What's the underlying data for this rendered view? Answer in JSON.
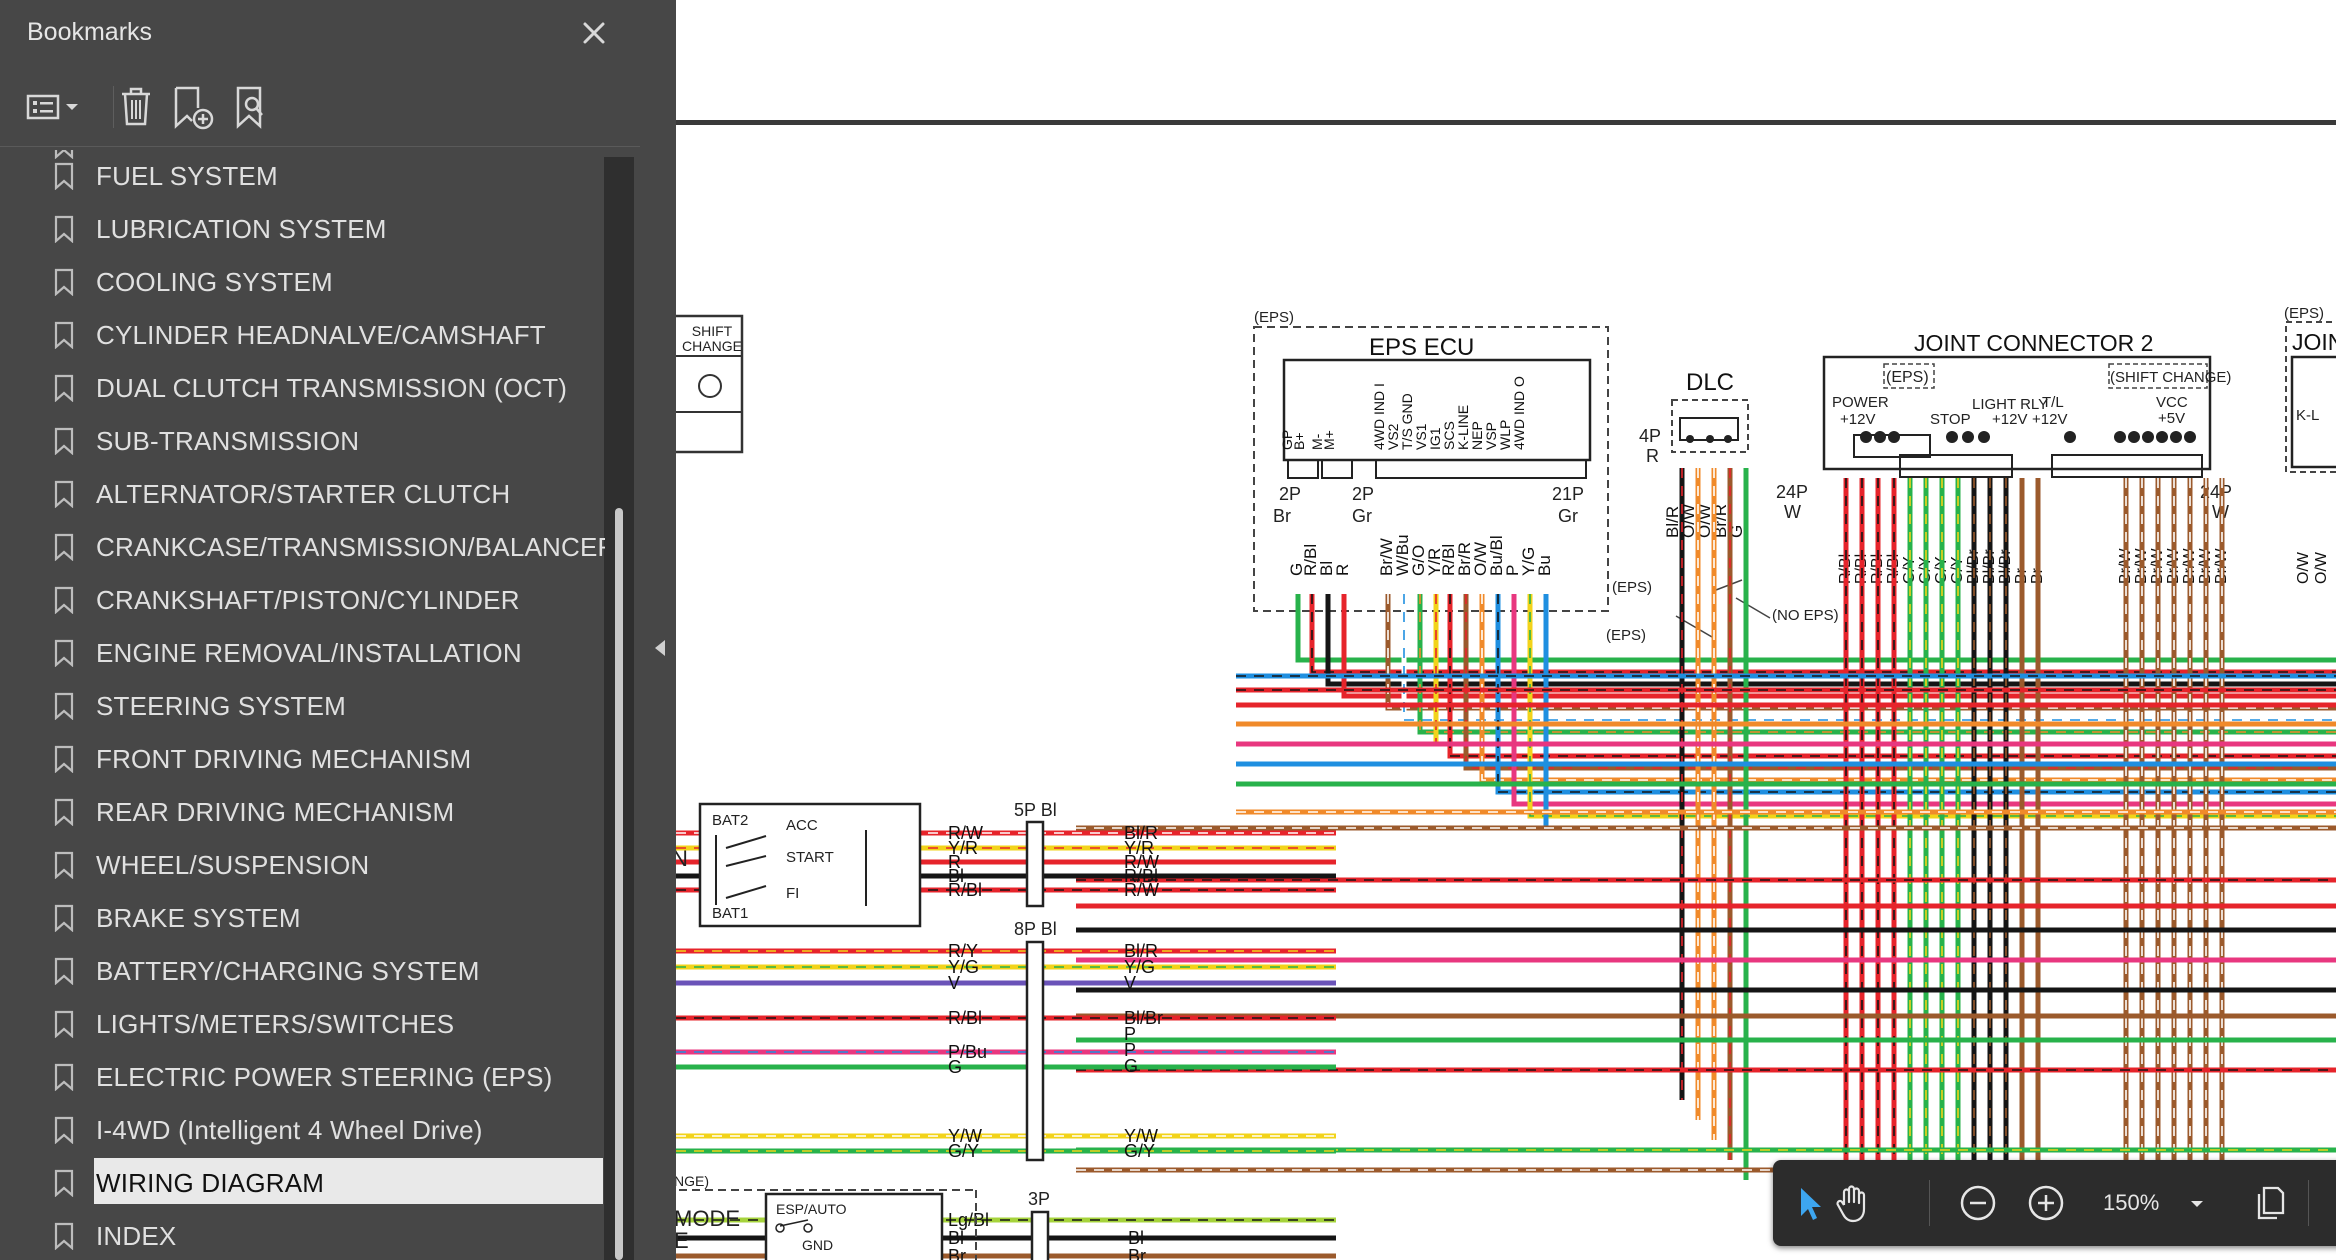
{
  "sidebar": {
    "title": "Bookmarks",
    "items": [
      {
        "label": "FUEL SYSTEM"
      },
      {
        "label": "LUBRICATION SYSTEM"
      },
      {
        "label": "COOLING SYSTEM"
      },
      {
        "label": "CYLINDER HEADNALVE/CAMSHAFT"
      },
      {
        "label": "DUAL CLUTCH TRANSMISSION (OCT)"
      },
      {
        "label": "SUB-TRANSMISSION"
      },
      {
        "label": "ALTERNATOR/STARTER CLUTCH"
      },
      {
        "label": "CRANKCASE/TRANSMISSION/BALANCER"
      },
      {
        "label": "CRANKSHAFT/PISTON/CYLINDER"
      },
      {
        "label": "ENGINE REMOVAL/INSTALLATION"
      },
      {
        "label": "STEERING SYSTEM"
      },
      {
        "label": "FRONT DRIVING MECHANISM"
      },
      {
        "label": "REAR DRIVING MECHANISM"
      },
      {
        "label": "WHEEL/SUSPENSION"
      },
      {
        "label": "BRAKE SYSTEM"
      },
      {
        "label": "BATTERY/CHARGING SYSTEM"
      },
      {
        "label": "LIGHTS/METERS/SWITCHES"
      },
      {
        "label": "ELECTRIC POWER STEERING (EPS)"
      },
      {
        "label": "I-4WD (Intelligent 4 Wheel Drive)"
      },
      {
        "label": "WIRING DIAGRAM",
        "selected": true
      },
      {
        "label": "INDEX"
      }
    ]
  },
  "toolbar": {
    "zoom": "150%"
  },
  "diagram": {
    "shift_change_1": "SHIFT",
    "shift_change_2": "CHANGE",
    "eps_tag": "(EPS)",
    "eps_ecu": "EPS ECU",
    "dlc": "DLC",
    "joint_connector": "JOINT CONNECTOR 2",
    "joint_partial": "JOIN",
    "eps_tag2": "(EPS)",
    "eps_tag3": "(EPS)",
    "eps_tag4": "(EPS)",
    "eps_tag5": "(EPS)",
    "no_eps": "(NO EPS)",
    "shift_change_tag": "(SHIFT CHANGE)",
    "power": "POWER",
    "p12v": "+12V",
    "stop": "STOP",
    "light_rly": "LIGHT RLY",
    "l12v": "+12V",
    "tl": "T/L",
    "tl12v": "+12V",
    "vcc": "VCC",
    "vcc5v": "+5V",
    "kl": "K-L",
    "c2p_left": "2P",
    "c2p_left_col": "Br",
    "c2p_mid": "2P",
    "c2p_mid_col": "Gr",
    "c21p": "21P",
    "c21p_col": "Gr",
    "c4p": "4P",
    "c4p_col": "R",
    "c24p_l": "24P",
    "c24p_l_col": "W",
    "c24p_r": "24P",
    "c24p_r_col": "W",
    "ecu_pins": [
      "GP",
      "B+",
      "M-",
      "M+",
      "4WD IND I",
      "VS2",
      "T/S GND",
      "VS1",
      "IG1",
      "SCS",
      "K-LINE",
      "NEP",
      "VSP",
      "WLP",
      "4WD IND O"
    ],
    "ecu_wires": [
      "G",
      "R/Bl",
      "Bl",
      "R",
      "Br/W",
      "W/Bu",
      "G/O",
      "Y/R",
      "R/Bl",
      "Br/R",
      "O/W",
      "Bu/Bl",
      "P",
      "Y/G",
      "Bu"
    ],
    "dlc_wires": [
      "Bl/R",
      "O/W",
      "O/W",
      "Br/R",
      "G"
    ],
    "jc_wires": [
      "R/Bl",
      "R/Bl",
      "R/Bl",
      "R/Bl",
      "G/Y",
      "G/Y",
      "G/Y",
      "G/Y",
      "Bl/Br",
      "Bl/Br",
      "Bl/Br",
      "Br",
      "Br",
      "Br/W",
      "Br/W",
      "Br/W",
      "Br/W",
      "Br/W",
      "Br/W",
      "Br/W"
    ],
    "jc_right_wires": [
      "O/W",
      "O/W"
    ],
    "bat2": "BAT2",
    "acc": "ACC",
    "start": "START",
    "fi": "FI",
    "bat1": "BAT1",
    "n_letter": "N",
    "c5p": "5P Bl",
    "c8p": "8P Bl",
    "c3p": "3P",
    "left_5p": [
      "R/W",
      "Y/R",
      "R",
      "Bl",
      "R/Bl"
    ],
    "right_5p": [
      "Bl/R",
      "Y/R",
      "R/W",
      "R/Bl",
      "R/W"
    ],
    "left_8p": [
      "R/Y",
      "Y/G",
      "V",
      "R/Bl",
      "P/Bu",
      "G",
      "Y/W",
      "G/Y"
    ],
    "right_8p": [
      "Bl/R",
      "Y/G",
      "V",
      "Bl/Br",
      "P",
      "P",
      "G",
      "Y/W",
      "G/Y"
    ],
    "nge": "NGE)",
    "mode": "MODE",
    "mode_e": "E",
    "esp_auto": "ESP/AUTO",
    "gnd": "GND",
    "left_3p": [
      "Lg/Bl",
      "Bl",
      "Br"
    ],
    "right_3p": [
      "Bl",
      "Br"
    ]
  }
}
